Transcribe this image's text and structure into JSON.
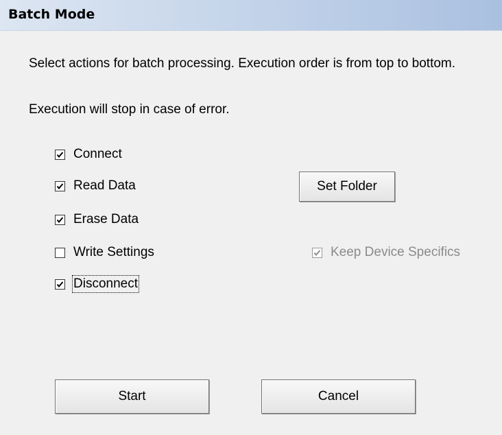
{
  "dialog": {
    "title": "Batch Mode",
    "description": "Select actions for batch processing. Execution order is from top to bottom.",
    "note": "Execution will stop in case of error."
  },
  "options": {
    "connect": {
      "label": "Connect",
      "checked": true
    },
    "read_data": {
      "label": "Read Data",
      "checked": true
    },
    "erase_data": {
      "label": "Erase Data",
      "checked": true
    },
    "write_settings": {
      "label": "Write Settings",
      "checked": false
    },
    "disconnect": {
      "label": "Disconnect",
      "checked": true
    },
    "keep_device_specifics": {
      "label": "Keep Device Specifics",
      "checked": true,
      "enabled": false
    }
  },
  "buttons": {
    "set_folder": "Set Folder",
    "start": "Start",
    "cancel": "Cancel"
  }
}
